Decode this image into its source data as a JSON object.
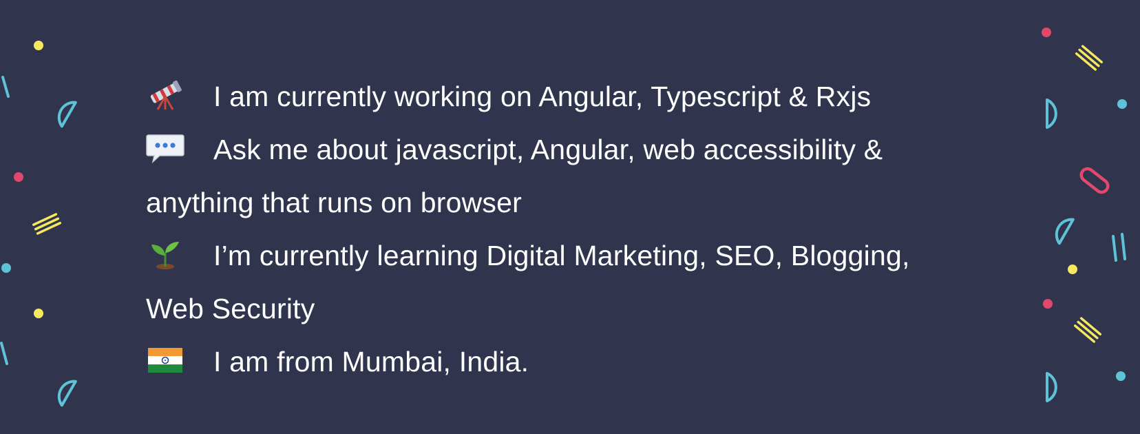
{
  "colors": {
    "background": "#30354d",
    "text": "#ffffff",
    "confetti_yellow": "#f7e95f",
    "confetti_cyan": "#5fc3d8",
    "confetti_pink": "#e2486e"
  },
  "items": [
    {
      "icon": "telescope-icon",
      "text": "I am currently working on Angular, Typescript & Rxjs"
    },
    {
      "icon": "speech-bubble-icon",
      "text": "Ask me about javascript, Angular, web accessibility &",
      "continuation": "anything that runs on browser"
    },
    {
      "icon": "seedling-icon",
      "text": "I’m currently learning Digital Marketing, SEO, Blogging,",
      "continuation": "Web Security"
    },
    {
      "icon": "india-flag-icon",
      "text": "I am from Mumbai, India."
    }
  ]
}
